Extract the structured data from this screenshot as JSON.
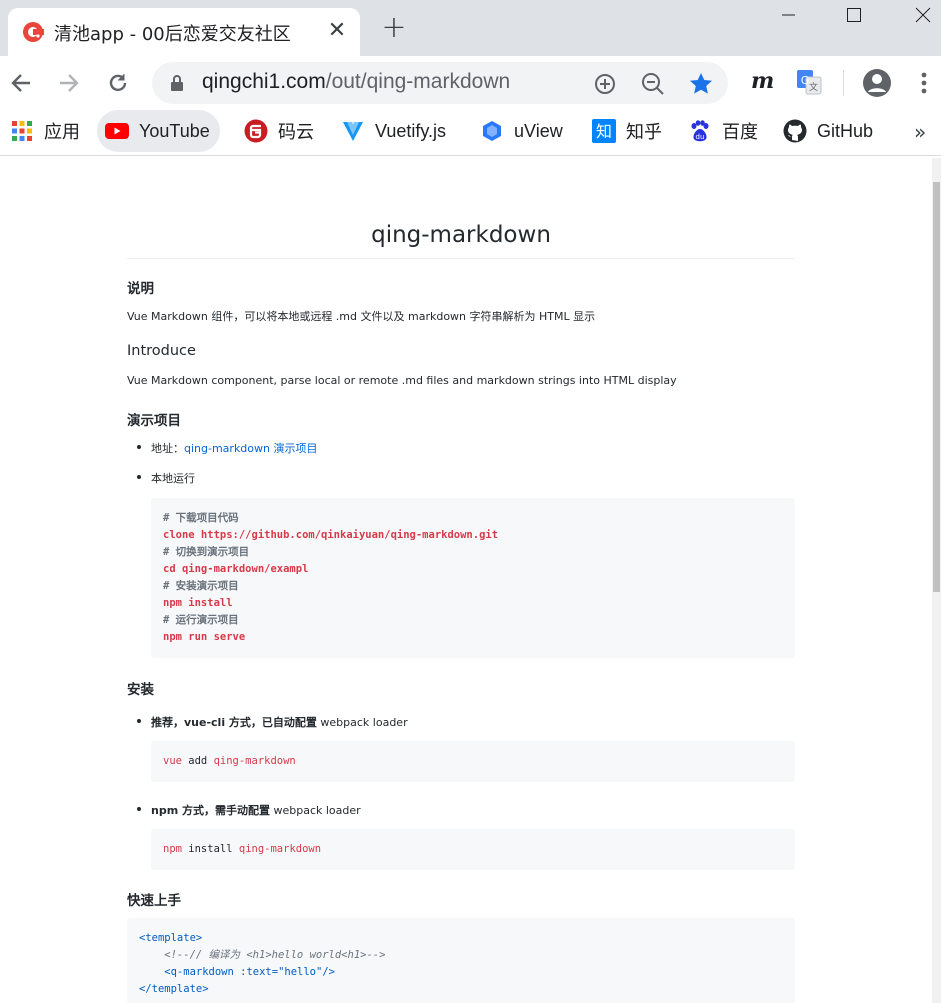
{
  "tab": {
    "title": "清池app - 00后恋爱交友社区"
  },
  "url": {
    "domain": "qingchi1.com",
    "path": "/out/qing-markdown"
  },
  "bookmarks": [
    {
      "label": "应用",
      "icon": "apps-grid-icon"
    },
    {
      "label": "YouTube",
      "icon": "youtube-icon"
    },
    {
      "label": "码云",
      "icon": "gitee-icon"
    },
    {
      "label": "Vuetify.js",
      "icon": "vuetify-icon"
    },
    {
      "label": "uView",
      "icon": "uview-icon"
    },
    {
      "label": "知乎",
      "icon": "zhihu-icon"
    },
    {
      "label": "百度",
      "icon": "baidu-icon"
    },
    {
      "label": "GitHub",
      "icon": "github-icon"
    }
  ],
  "bookmarks_more": "»",
  "doc": {
    "title": "qing-markdown",
    "s1_heading": "说明",
    "s1_text": "Vue Markdown 组件，可以将本地或远程 .md 文件以及 markdown 字符串解析为 HTML 显示",
    "s2_heading": "Introduce",
    "s2_text": "Vue Markdown component, parse local or remote .md files and markdown strings into HTML display",
    "s3_heading": "演示项目",
    "s3_li1_prefix": "地址：",
    "s3_li1_link": "qing-markdown 演示项目",
    "s3_li2": "本地运行",
    "code1": [
      "# 下载项目代码",
      "clone https://github.com/qinkaiyuan/qing-markdown.git",
      "# 切换到演示项目",
      "cd qing-markdown/exampl",
      "# 安装演示项目",
      "npm install",
      "# 运行演示项目",
      "npm run serve"
    ],
    "s4_heading": "安装",
    "s4_li1_bold": "推荐，vue-cli 方式，已自动配置",
    "s4_li1_rest": " webpack loader",
    "code2": {
      "a": "vue",
      "b": " add ",
      "c": "qing-markdown"
    },
    "s4_li2_bold": "npm 方式，需手动配置",
    "s4_li2_rest": " webpack loader",
    "code3": {
      "a": "npm",
      "b": " install ",
      "c": "qing-markdown"
    },
    "s5_heading": "快速上手",
    "code4": [
      "<template>",
      "    <!--// 编译为 <h1>hello world<h1>-->",
      "    <q-markdown :text=\"hello\"/>",
      "</template>"
    ]
  }
}
